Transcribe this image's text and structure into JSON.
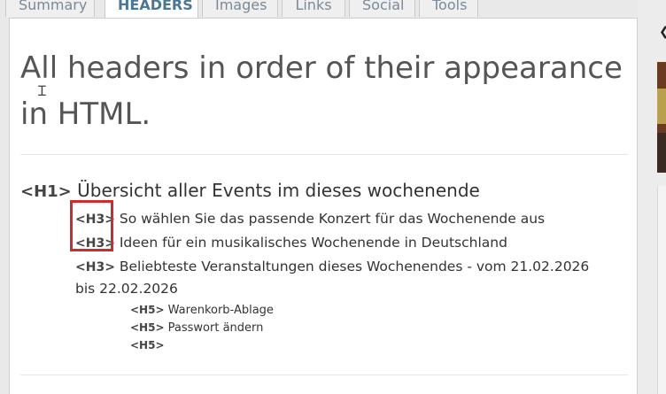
{
  "tabs": [
    {
      "label": "Summary",
      "active": false
    },
    {
      "label": "HEADERS",
      "active": true
    },
    {
      "label": "Images",
      "active": false
    },
    {
      "label": "Links",
      "active": false
    },
    {
      "label": "Social",
      "active": false
    },
    {
      "label": "Tools",
      "active": false
    }
  ],
  "page_title": "All headers in order of their appearance in HTML.",
  "headers": [
    {
      "tag": "<H1>",
      "text": "Übersicht aller Events im dieses wochenende"
    },
    {
      "tag": "<H3>",
      "text": "So wählen Sie das passende Konzert für das Wochenende aus"
    },
    {
      "tag": "<H3>",
      "text": "Ideen für ein musikalisches Wochenende in Deutschland"
    },
    {
      "tag": "<H3>",
      "text": "Beliebteste Veranstaltungen dieses Wochenendes - vom 21.02.2026 bis 22.02.2026"
    },
    {
      "tag": "<H5>",
      "text": "Warenkorb-Ablage"
    },
    {
      "tag": "<H5>",
      "text": "Passwort ändern"
    },
    {
      "tag": "<H5>",
      "text": ""
    }
  ],
  "colors": {
    "highlight": "#d22a2a",
    "active_tab": "#4a7797",
    "inactive_tab": "#7a8a99"
  },
  "side_strip": {
    "chevron": "❮"
  }
}
